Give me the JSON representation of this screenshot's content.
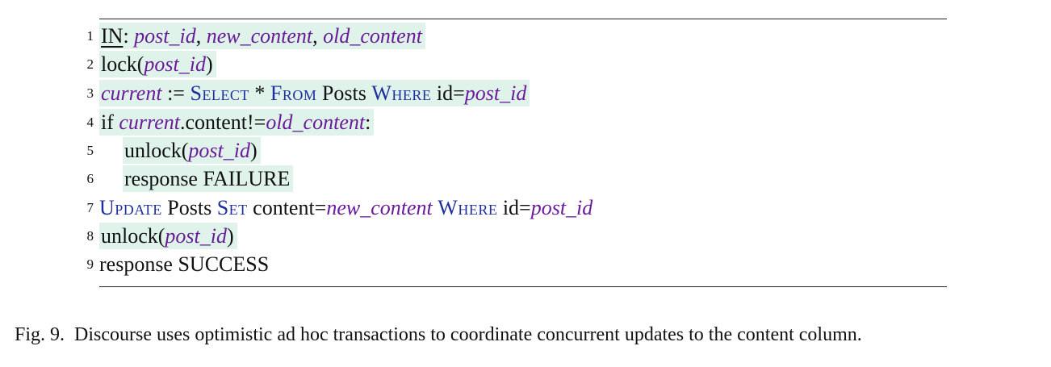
{
  "listing": {
    "lines": [
      {
        "num": "1",
        "parts": [
          "IN",
          ": ",
          "post_id",
          ", ",
          "new_content",
          ", ",
          "old_content"
        ]
      },
      {
        "num": "2",
        "parts": [
          "lock(",
          "post_id",
          ")"
        ]
      },
      {
        "num": "3",
        "parts": [
          "current",
          " := ",
          "Select",
          " * ",
          "From",
          " Posts ",
          "Where",
          " id=",
          "post_id"
        ]
      },
      {
        "num": "4",
        "parts": [
          "if ",
          "current",
          ".content!=",
          "old_content",
          ":"
        ]
      },
      {
        "num": "5",
        "parts": [
          "unlock(",
          "post_id",
          ")"
        ]
      },
      {
        "num": "6",
        "parts": [
          "response FAILURE"
        ]
      },
      {
        "num": "7",
        "parts": [
          "Update",
          " Posts ",
          "Set",
          " content=",
          "new_content",
          " ",
          "Where",
          " id=",
          "post_id"
        ]
      },
      {
        "num": "8",
        "parts": [
          "unlock(",
          "post_id",
          ")"
        ]
      },
      {
        "num": "9",
        "parts": [
          "response SUCCESS"
        ]
      }
    ]
  },
  "caption": {
    "label": "Fig. 9.",
    "text": "Discourse uses optimistic ad hoc transactions to coordinate concurrent updates to the content column."
  },
  "colors": {
    "highlight": "#dff3ea",
    "variable": "#6a1b9a",
    "keyword": "#1d2f9c"
  }
}
